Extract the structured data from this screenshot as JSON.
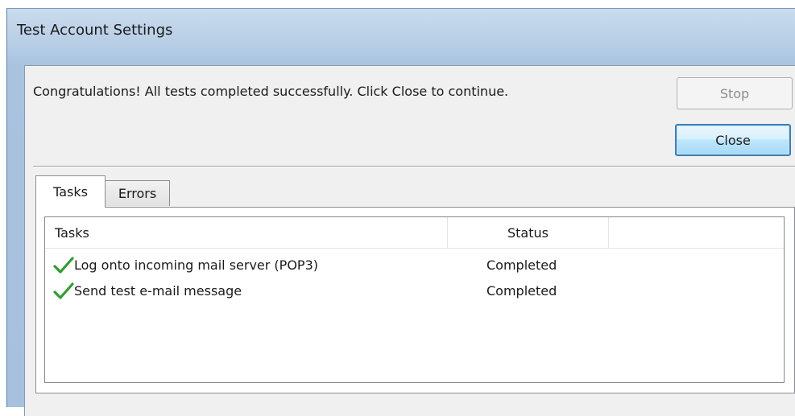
{
  "window": {
    "title": "Test Account Settings"
  },
  "message": "Congratulations! All tests completed successfully. Click Close to continue.",
  "buttons": {
    "stop": "Stop",
    "close": "Close"
  },
  "tabs": [
    {
      "label": "Tasks",
      "active": true
    },
    {
      "label": "Errors",
      "active": false
    }
  ],
  "table": {
    "columns": [
      "Tasks",
      "Status",
      ""
    ],
    "rows": [
      {
        "icon": "checkmark-icon",
        "task": "Log onto incoming mail server (POP3)",
        "status": "Completed"
      },
      {
        "icon": "checkmark-icon",
        "task": "Send test e-mail message",
        "status": "Completed"
      }
    ]
  },
  "colors": {
    "check": "#2f9e2f",
    "close_border": "#3c7fb1"
  }
}
